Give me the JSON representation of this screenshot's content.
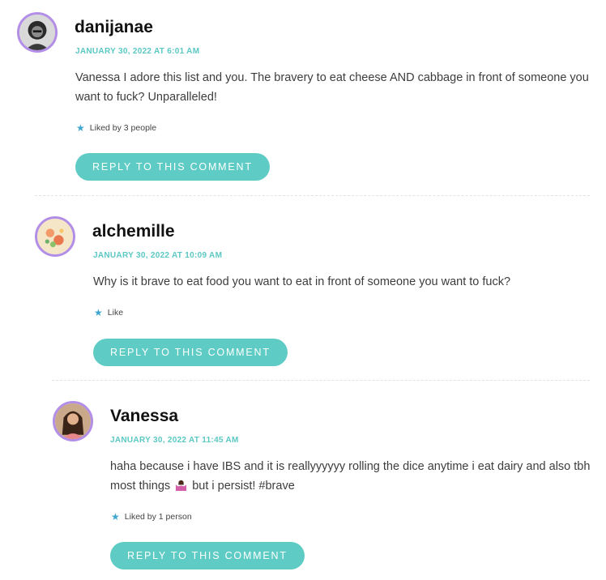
{
  "comments": [
    {
      "author": "danijanae",
      "date": "JANUARY 30, 2022 AT 6:01 AM",
      "text_line1": "Vanessa I adore this list and you. The bravery to eat cheese AND cabbage in front of someone you",
      "text_line2": "want to fuck? Unparalleled!",
      "likes": "Liked by 3 people",
      "reply_label": "REPLY TO THIS COMMENT"
    },
    {
      "author": "alchemille",
      "date": "JANUARY 30, 2022 AT 10:09 AM",
      "text_line1": "Why is it brave to eat food you want to eat in front of someone you want to fuck?",
      "likes": "Like",
      "reply_label": "REPLY TO THIS COMMENT"
    },
    {
      "author": "Vanessa",
      "date": "JANUARY 30, 2022 AT 11:45 AM",
      "text_line1": "haha because i have IBS and it is reallyyyyyy rolling the dice anytime i eat dairy and also tbh",
      "text_line2_before": "most things",
      "text_line2_after": "but i persist! #brave",
      "likes": "Liked by 1 person",
      "reply_label": "REPLY TO THIS COMMENT"
    }
  ],
  "colors": {
    "accent": "#5fcbc5",
    "avatar_border": "#b38ee6",
    "star": "#3ea7cf"
  }
}
